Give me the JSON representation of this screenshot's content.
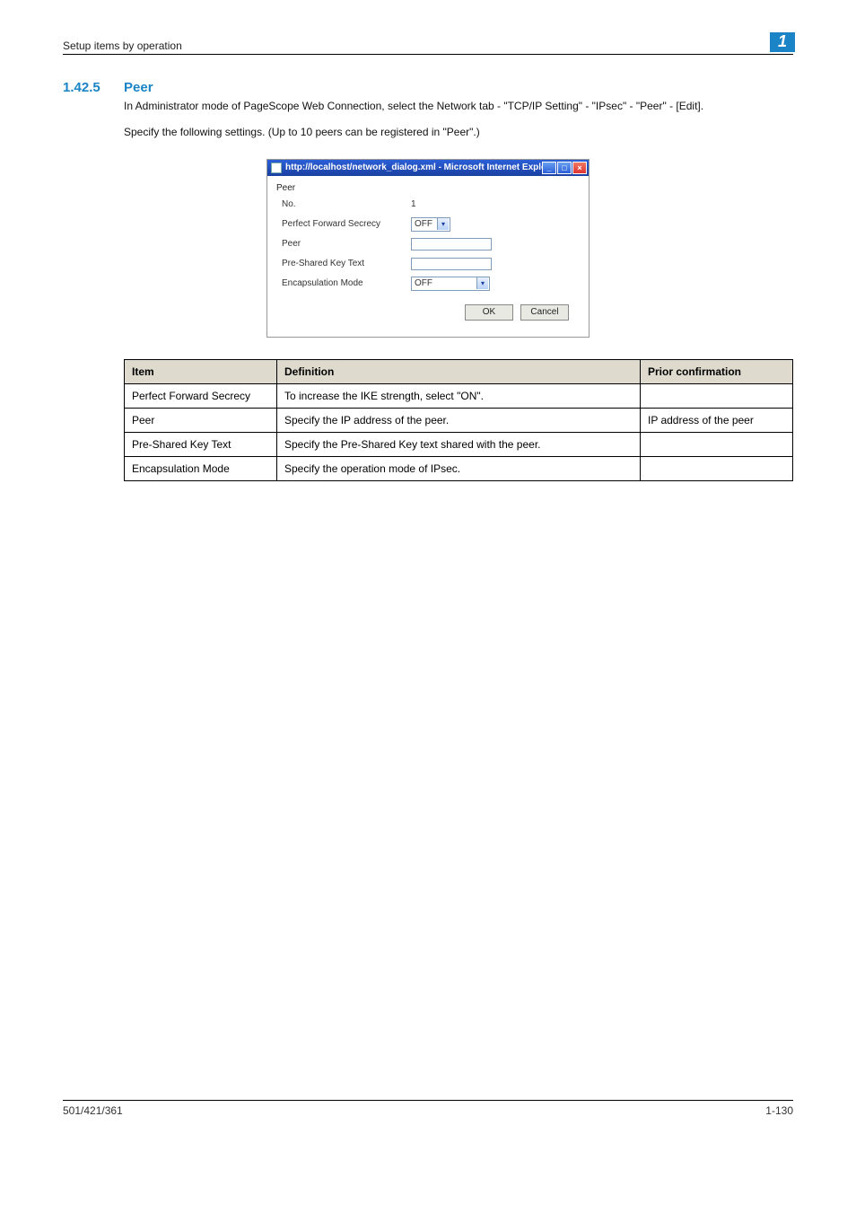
{
  "header": {
    "running_title": "Setup items by operation",
    "chapter_number": "1"
  },
  "section": {
    "number": "1.42.5",
    "title": "Peer",
    "paragraph1": "In Administrator mode of PageScope Web Connection, select the Network tab - \"TCP/IP Setting\" - \"IPsec\" - \"Peer\" - [Edit].",
    "paragraph2": "Specify the following settings. (Up to 10 peers can be registered in \"Peer\".)"
  },
  "dialog": {
    "title": "http://localhost/network_dialog.xml - Microsoft Internet Explorer",
    "min_icon": "_",
    "max_icon": "□",
    "close_icon": "×",
    "section_label": "Peer",
    "rows": {
      "no_label": "No.",
      "no_value": "1",
      "pfs_label": "Perfect Forward Secrecy",
      "pfs_value": "OFF",
      "peer_label": "Peer",
      "peer_value": "",
      "psk_label": "Pre-Shared Key Text",
      "psk_value": "",
      "encap_label": "Encapsulation Mode",
      "encap_value": "OFF"
    },
    "ok_label": "OK",
    "cancel_label": "Cancel"
  },
  "table": {
    "headers": {
      "item": "Item",
      "definition": "Definition",
      "prior": "Prior confirmation"
    },
    "rows": [
      {
        "item": "Perfect Forward Secrecy",
        "definition": "To increase the IKE strength, select \"ON\".",
        "prior": ""
      },
      {
        "item": "Peer",
        "definition": "Specify the IP address of the peer.",
        "prior": "IP address of the peer"
      },
      {
        "item": "Pre-Shared Key Text",
        "definition": "Specify the Pre-Shared Key text shared with the peer.",
        "prior": ""
      },
      {
        "item": "Encapsulation Mode",
        "definition": "Specify the operation mode of IPsec.",
        "prior": ""
      }
    ]
  },
  "footer": {
    "left": "501/421/361",
    "right": "1-130"
  }
}
